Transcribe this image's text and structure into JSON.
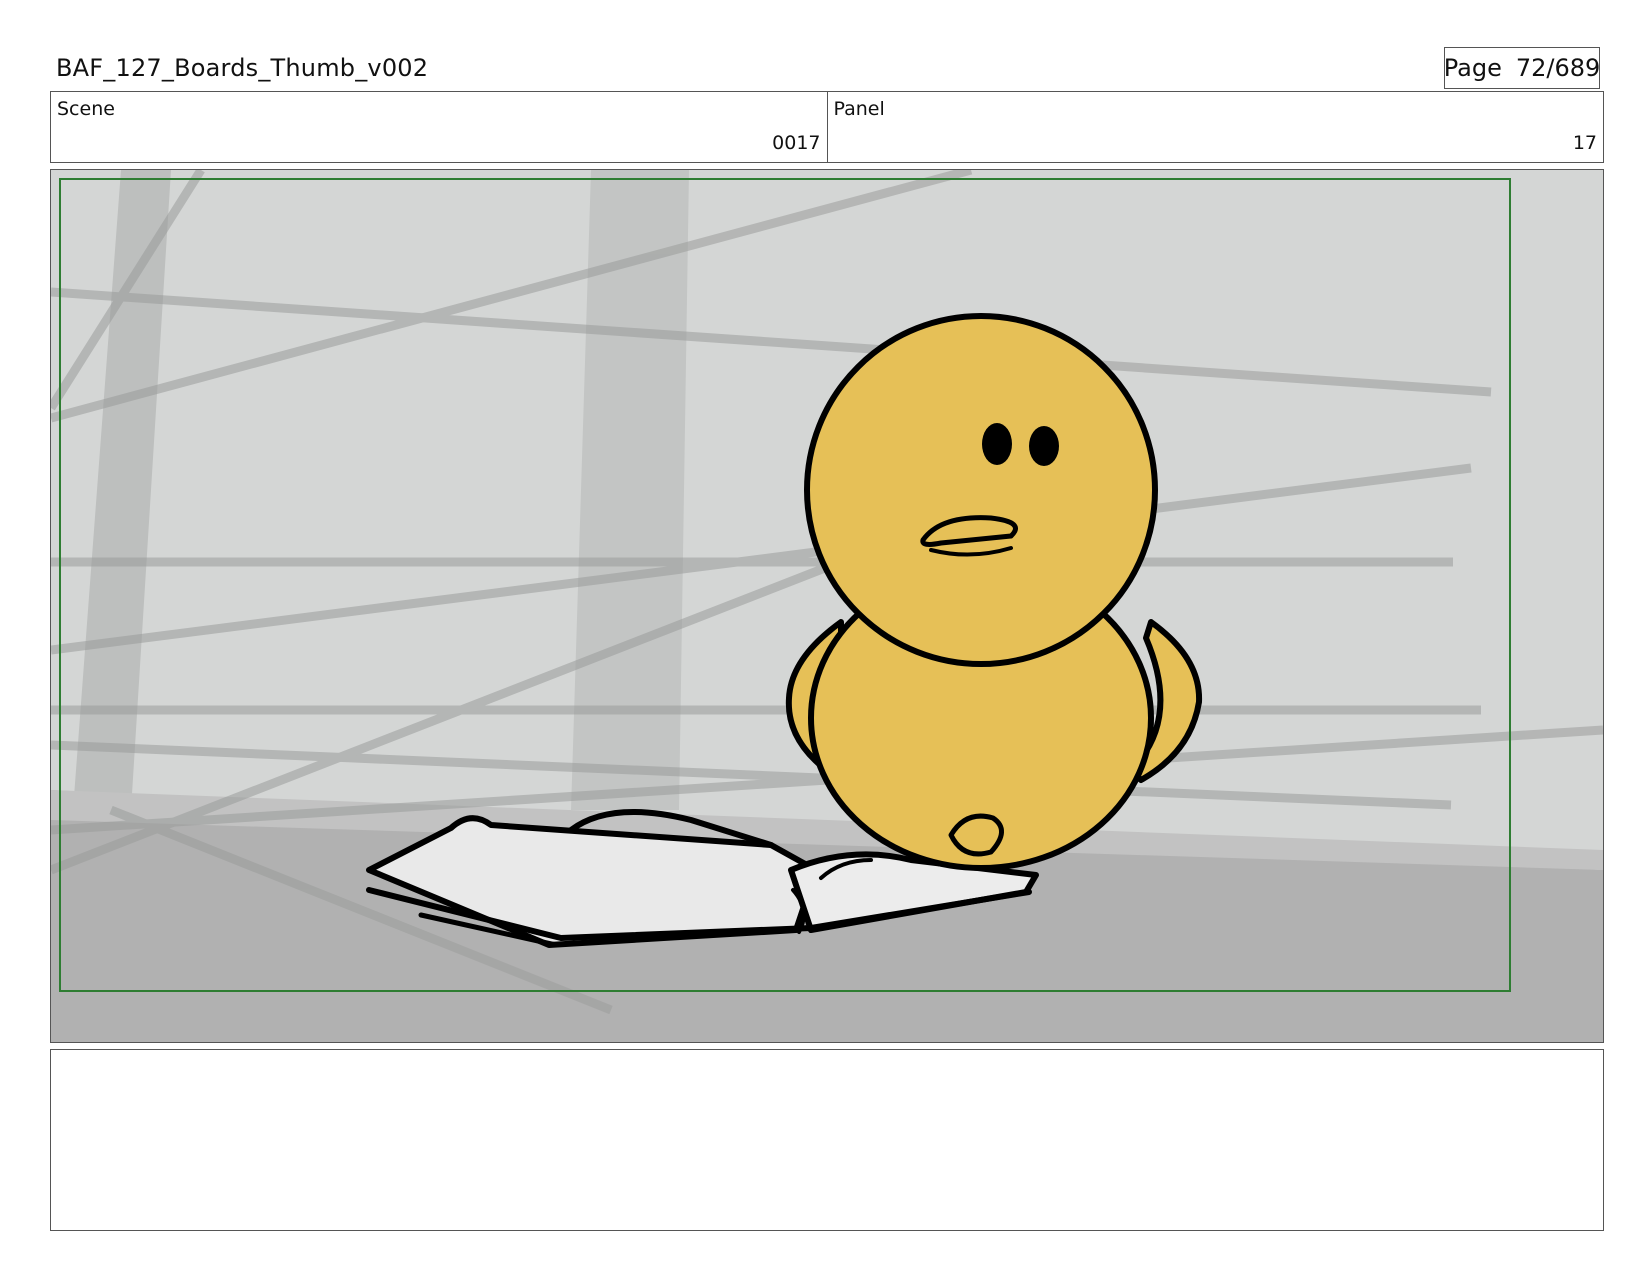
{
  "header": {
    "document_title": "BAF_127_Boards_Thumb_v002",
    "page_label": "Page",
    "page_number": "72/689"
  },
  "info": {
    "scene_label": "Scene",
    "scene_value": "0017",
    "panel_label": "Panel",
    "panel_value": "17"
  },
  "panel_image": {
    "safe_area_color": "#2e7d32",
    "chick_color": "#e6c057",
    "wall_color": "#cfd1d0",
    "floor_color": "#acacac"
  },
  "notes": {
    "text": ""
  }
}
